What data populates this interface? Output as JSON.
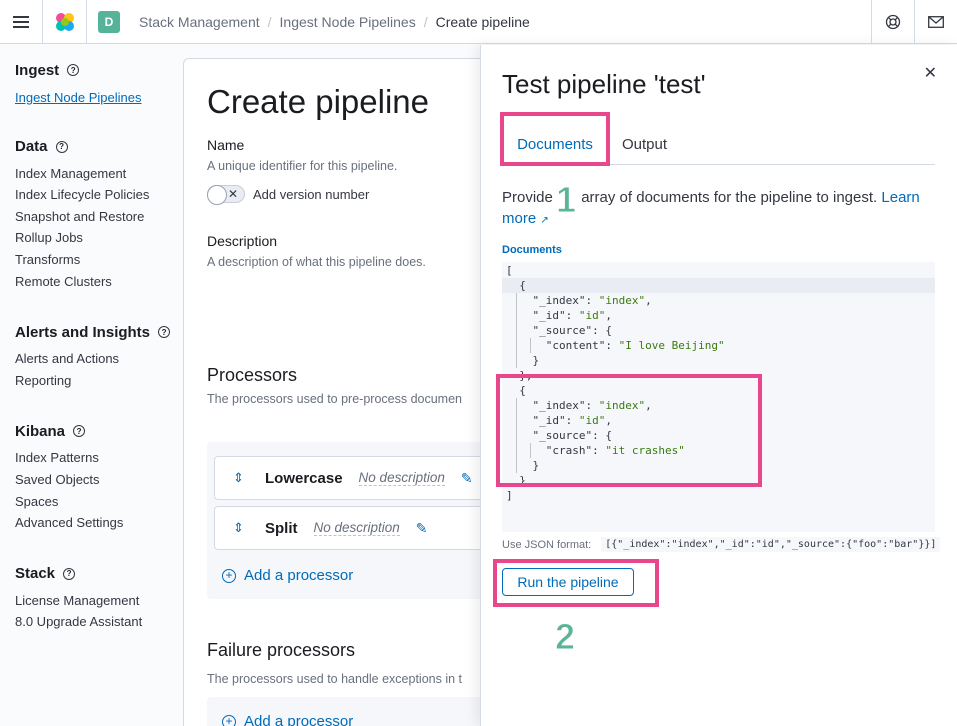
{
  "header": {
    "space_initial": "D",
    "breadcrumbs": [
      "Stack Management",
      "Ingest Node Pipelines",
      "Create pipeline"
    ],
    "menu_icon": "hamburger-menu-icon",
    "logo_icon": "elastic-logo-icon",
    "help_icon": "help-lifebuoy-icon",
    "news_icon": "newsfeed-mail-icon"
  },
  "sidebar": {
    "groups": [
      {
        "title": "Ingest",
        "items": [
          "Ingest Node Pipelines"
        ]
      },
      {
        "title": "Data",
        "items": [
          "Index Management",
          "Index Lifecycle Policies",
          "Snapshot and Restore",
          "Rollup Jobs",
          "Transforms",
          "Remote Clusters"
        ]
      },
      {
        "title": "Alerts and Insights",
        "items": [
          "Alerts and Actions",
          "Reporting"
        ]
      },
      {
        "title": "Kibana",
        "items": [
          "Index Patterns",
          "Saved Objects",
          "Spaces",
          "Advanced Settings"
        ]
      },
      {
        "title": "Stack",
        "items": [
          "License Management",
          "8.0 Upgrade Assistant"
        ]
      }
    ]
  },
  "main": {
    "title": "Create pipeline",
    "name_label": "Name",
    "name_help": "A unique identifier for this pipeline.",
    "version_toggle": "Add version number",
    "description_label": "Description",
    "description_help": "A description of what this pipeline does.",
    "processors_title": "Processors",
    "processors_help": "The processors used to pre-process documen",
    "processors": [
      {
        "name": "Lowercase",
        "desc": "No description"
      },
      {
        "name": "Split",
        "desc": "No description"
      }
    ],
    "add_processor": "Add a processor",
    "failure_title": "Failure processors",
    "failure_help": "The processors used to handle exceptions in t",
    "add_processor_2": "Add a processor"
  },
  "flyout": {
    "title": "Test pipeline 'test'",
    "tabs": [
      "Documents",
      "Output"
    ],
    "intro_pre": "Provide",
    "intro_post": "array of documents for the pipeline to ingest.",
    "learn_more_1": "Learn",
    "learn_more_2": "more",
    "documents_label": "Documents",
    "code_lines": [
      "[",
      "  {",
      "    \"_index\": \"index\",",
      "    \"_id\": \"id\",",
      "    \"_source\": {",
      "      \"content\": \"I love Beijing\"",
      "    }",
      "  },",
      "  {",
      "    \"_index\": \"index\",",
      "    \"_id\": \"id\",",
      "    \"_source\": {",
      "      \"crash\": \"it crashes\"",
      "    }",
      "  }",
      "]"
    ],
    "format_label": "Use JSON format:",
    "format_example": "[{\"_index\":\"index\",\"_id\":\"id\",\"_source\":{\"foo\":\"bar\"}}]",
    "run_button": "Run the pipeline"
  },
  "annotations": {
    "step1": "1",
    "step2": "2",
    "highlight_color": "#e8478b",
    "step_color": "#5cb498"
  }
}
